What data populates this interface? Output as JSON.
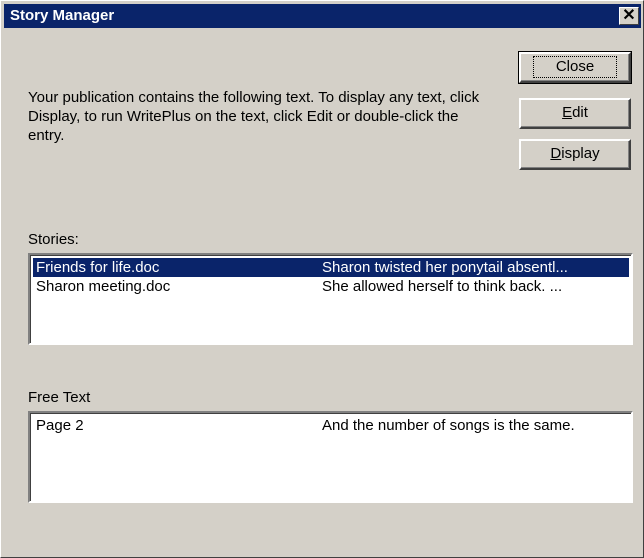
{
  "window": {
    "title": "Story Manager",
    "close_glyph": "✕"
  },
  "intro_text": "Your publication contains the following text. To display any text, click Display, to run WritePlus on the text, click Edit or double-click the entry.",
  "buttons": {
    "close": "Close",
    "edit_prefix": "E",
    "edit_rest": "dit",
    "display_prefix": "D",
    "display_rest": "isplay"
  },
  "stories": {
    "label": "Stories:",
    "items": [
      {
        "name": "Friends for life.doc",
        "preview": "Sharon twisted her ponytail absentl...",
        "selected": true
      },
      {
        "name": "Sharon meeting.doc",
        "preview": "She allowed herself to think back. ...",
        "selected": false
      }
    ]
  },
  "free_text": {
    "label": "Free Text",
    "items": [
      {
        "name": "Page 2",
        "preview": "And the number of songs is the same.",
        "selected": false
      }
    ]
  }
}
